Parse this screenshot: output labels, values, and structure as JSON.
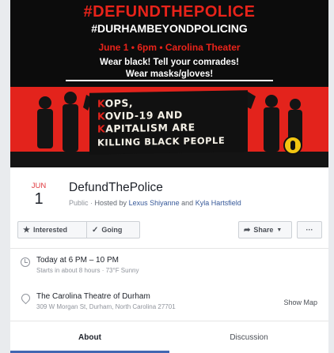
{
  "poster": {
    "hashtag_main": "#DEFUNDTHEPOLICE",
    "hashtag_sub": "#DURHAMBEYONDPOLICING",
    "event_line": "June 1 • 6pm • Carolina Theater",
    "call_line_1": "Wear black! Tell your comrades!",
    "call_line_2": "Wear masks/gloves!",
    "banner_lines": [
      "KOPS,",
      "KOVID-19 AND",
      "KAPITALISM ARE",
      "KILLING BLACK PEOPLE"
    ]
  },
  "event": {
    "month": "JUN",
    "day": "1",
    "title": "DefundThePolice",
    "visibility": "Public",
    "hosted_by_label": "Hosted by",
    "host1": "Lexus Shiyanne",
    "and_label": "and",
    "host2": "Kyla Hartsfield"
  },
  "actions": {
    "interested": "Interested",
    "going": "Going",
    "share": "Share",
    "more": "···"
  },
  "details": {
    "time": "Today at 6 PM – 10 PM",
    "time_sub": "Starts in about 8 hours · 73°F Sunny",
    "place": "The Carolina Theatre of Durham",
    "address": "309 W Morgan St, Durham, North Carolina 27701",
    "show_map": "Show Map"
  },
  "tabs": {
    "about": "About",
    "discussion": "Discussion"
  },
  "colors": {
    "poster_red": "#e3231c",
    "date_red": "#e0393e",
    "link_blue": "#365899",
    "tab_underline": "#4267b2"
  },
  "icons": [
    "star-icon",
    "check-icon",
    "share-arrow-icon",
    "caret-down-icon",
    "more-icon",
    "clock-icon",
    "pin-icon"
  ]
}
